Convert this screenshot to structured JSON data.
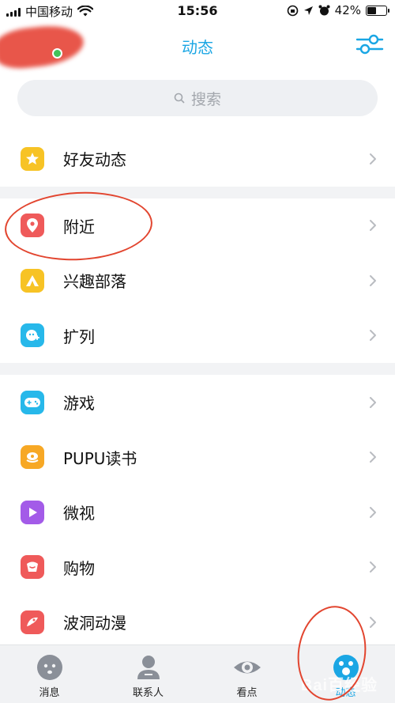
{
  "status_bar": {
    "carrier": "中国移动",
    "time": "15:56",
    "battery": "42%",
    "battery_level": 0.42
  },
  "header": {
    "title": "动态",
    "filter_icon": "sliders-icon"
  },
  "search": {
    "placeholder": "搜索",
    "icon": "search-icon"
  },
  "groups": [
    {
      "items": [
        {
          "label": "好友动态",
          "icon": "star-icon",
          "color": "#f7c325"
        }
      ]
    },
    {
      "items": [
        {
          "label": "附近",
          "icon": "location-pin-icon",
          "color": "#ef5a5a"
        },
        {
          "label": "兴趣部落",
          "icon": "tent-icon",
          "color": "#f7c325"
        },
        {
          "label": "扩列",
          "icon": "expand-friends-icon",
          "color": "#27b8ea"
        }
      ]
    },
    {
      "items": [
        {
          "label": "游戏",
          "icon": "gamepad-icon",
          "color": "#27b8ea"
        },
        {
          "label": "PUPU读书",
          "icon": "book-icon",
          "color": "#f7a825"
        },
        {
          "label": "微视",
          "icon": "video-play-icon",
          "color": "#a35be8"
        },
        {
          "label": "购物",
          "icon": "shopping-icon",
          "color": "#ef5a5a"
        },
        {
          "label": "波洞动漫",
          "icon": "comic-icon",
          "color": "#ef5a5a"
        }
      ]
    }
  ],
  "bottom_nav": [
    {
      "label": "消息",
      "icon": "message-icon",
      "active": false
    },
    {
      "label": "联系人",
      "icon": "contacts-icon",
      "active": false
    },
    {
      "label": "看点",
      "icon": "eye-icon",
      "active": false
    },
    {
      "label": "动态",
      "icon": "star-paw-icon",
      "active": true
    }
  ],
  "watermark": "Bai百经验",
  "colors": {
    "accent": "#1aa6e4",
    "annotation": "#e2452f",
    "online": "#42c25a"
  }
}
